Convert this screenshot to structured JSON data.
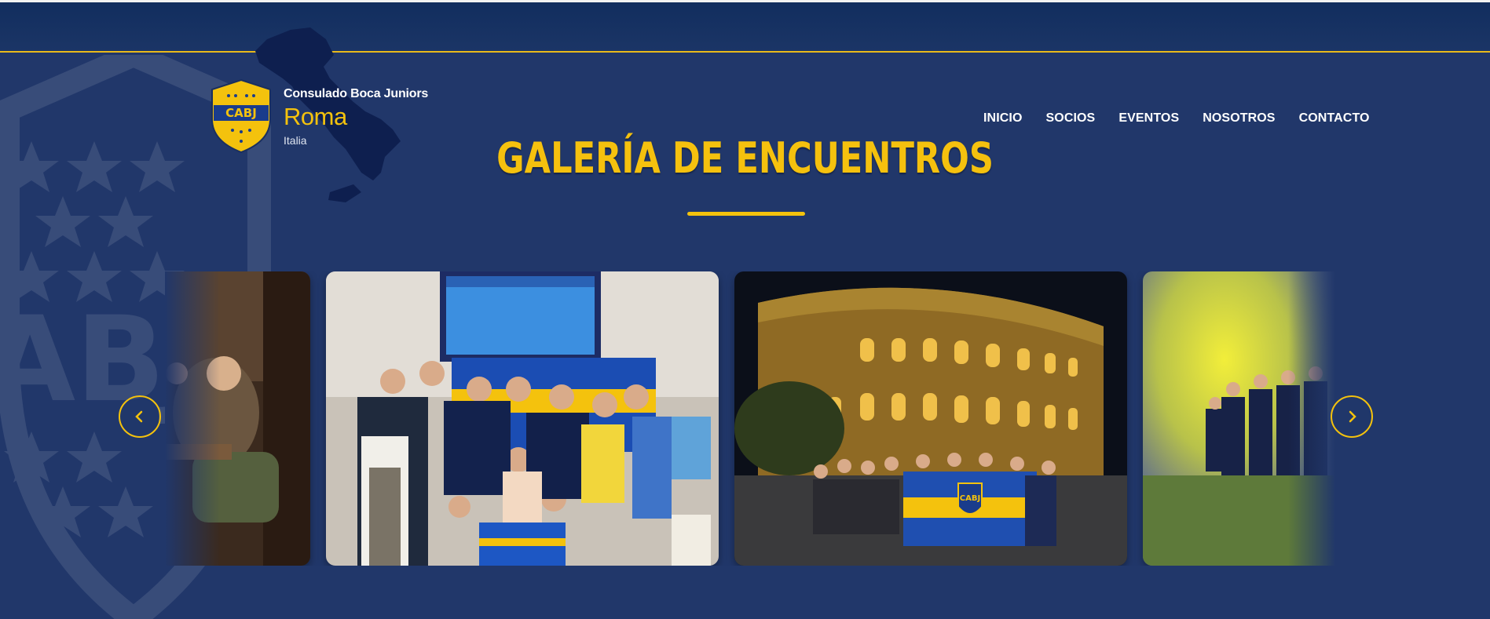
{
  "brand": {
    "logo_text": "CABJ",
    "line1": "Consulado Boca Juniors",
    "line2": "Roma",
    "line3": "Italia"
  },
  "nav": {
    "items": [
      {
        "label": "INICIO"
      },
      {
        "label": "SOCIOS"
      },
      {
        "label": "EVENTOS"
      },
      {
        "label": "NOSOTROS"
      },
      {
        "label": "CONTACTO"
      }
    ]
  },
  "gallery": {
    "title": "GALERÍA DE ENCUENTROS",
    "prev_icon": "chevron-left-icon",
    "next_icon": "chevron-right-icon",
    "slides": [
      {
        "name": "bar-photo"
      },
      {
        "name": "group-photo"
      },
      {
        "name": "colosseum-photo",
        "flag_text": "CABJ"
      },
      {
        "name": "smoke-photo"
      }
    ]
  },
  "colors": {
    "background": "#21376a",
    "accent": "#f4c20d",
    "topbar": "#112d5e"
  }
}
